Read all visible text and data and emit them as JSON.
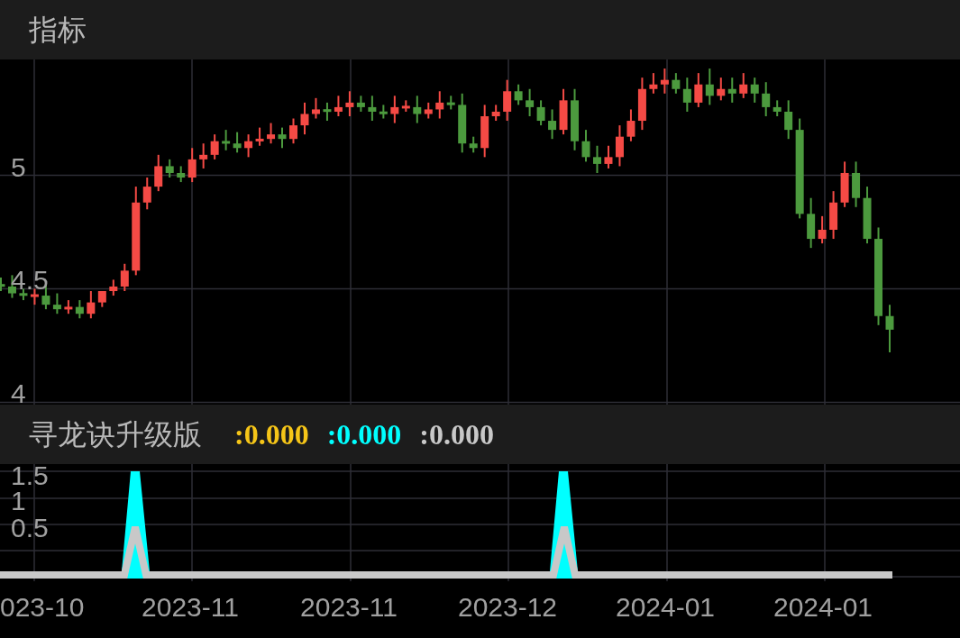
{
  "indicator_header": {
    "title": "指标"
  },
  "price_chart": {
    "chart_data": {
      "type": "candlestick",
      "grid": true,
      "ylim": [
        3.99,
        5.51
      ],
      "yticks": [
        {
          "value": 5,
          "label": "5"
        },
        {
          "value": 4.5,
          "label": "4.5"
        },
        {
          "value": 4,
          "label": "4"
        }
      ],
      "ohlc": [
        [
          4.52,
          4.55,
          4.49,
          4.51
        ],
        [
          4.51,
          4.56,
          4.46,
          4.48
        ],
        [
          4.48,
          4.5,
          4.45,
          4.47
        ],
        [
          4.47,
          4.5,
          4.43,
          4.47
        ],
        [
          4.47,
          4.52,
          4.41,
          4.43
        ],
        [
          4.43,
          4.48,
          4.39,
          4.41
        ],
        [
          4.41,
          4.45,
          4.39,
          4.42
        ],
        [
          4.42,
          4.45,
          4.37,
          4.39
        ],
        [
          4.39,
          4.49,
          4.37,
          4.44
        ],
        [
          4.44,
          4.49,
          4.42,
          4.49
        ],
        [
          4.49,
          4.54,
          4.47,
          4.51
        ],
        [
          4.51,
          4.61,
          4.49,
          4.58
        ],
        [
          4.58,
          4.95,
          4.56,
          4.88
        ],
        [
          4.88,
          4.99,
          4.85,
          4.95
        ],
        [
          4.95,
          5.09,
          4.93,
          5.04
        ],
        [
          5.04,
          5.07,
          4.99,
          5.01
        ],
        [
          5.01,
          5.04,
          4.97,
          4.99
        ],
        [
          4.99,
          5.12,
          4.97,
          5.07
        ],
        [
          5.07,
          5.14,
          5.03,
          5.09
        ],
        [
          5.09,
          5.18,
          5.07,
          5.15
        ],
        [
          5.15,
          5.2,
          5.11,
          5.14
        ],
        [
          5.14,
          5.19,
          5.1,
          5.12
        ],
        [
          5.12,
          5.18,
          5.08,
          5.15
        ],
        [
          5.15,
          5.21,
          5.13,
          5.16
        ],
        [
          5.16,
          5.23,
          5.14,
          5.18
        ],
        [
          5.18,
          5.21,
          5.12,
          5.16
        ],
        [
          5.16,
          5.25,
          5.14,
          5.22
        ],
        [
          5.22,
          5.32,
          5.18,
          5.27
        ],
        [
          5.27,
          5.34,
          5.25,
          5.29
        ],
        [
          5.29,
          5.32,
          5.24,
          5.28
        ],
        [
          5.28,
          5.35,
          5.26,
          5.3
        ],
        [
          5.3,
          5.37,
          5.26,
          5.32
        ],
        [
          5.32,
          5.35,
          5.28,
          5.3
        ],
        [
          5.3,
          5.35,
          5.24,
          5.28
        ],
        [
          5.28,
          5.31,
          5.25,
          5.27
        ],
        [
          5.27,
          5.35,
          5.23,
          5.3
        ],
        [
          5.3,
          5.33,
          5.28,
          5.3
        ],
        [
          5.3,
          5.35,
          5.23,
          5.27
        ],
        [
          5.27,
          5.32,
          5.25,
          5.29
        ],
        [
          5.29,
          5.37,
          5.25,
          5.32
        ],
        [
          5.32,
          5.35,
          5.29,
          5.31
        ],
        [
          5.31,
          5.36,
          5.1,
          5.14
        ],
        [
          5.14,
          5.17,
          5.1,
          5.12
        ],
        [
          5.12,
          5.31,
          5.08,
          5.26
        ],
        [
          5.26,
          5.31,
          5.24,
          5.28
        ],
        [
          5.28,
          5.42,
          5.24,
          5.37
        ],
        [
          5.37,
          5.4,
          5.31,
          5.33
        ],
        [
          5.33,
          5.38,
          5.26,
          5.3
        ],
        [
          5.3,
          5.33,
          5.22,
          5.24
        ],
        [
          5.24,
          5.29,
          5.16,
          5.2
        ],
        [
          5.2,
          5.38,
          5.18,
          5.33
        ],
        [
          5.33,
          5.38,
          5.11,
          5.15
        ],
        [
          5.15,
          5.2,
          5.06,
          5.08
        ],
        [
          5.08,
          5.13,
          5.01,
          5.05
        ],
        [
          5.05,
          5.13,
          5.03,
          5.08
        ],
        [
          5.08,
          5.22,
          5.04,
          5.17
        ],
        [
          5.17,
          5.29,
          5.15,
          5.24
        ],
        [
          5.24,
          5.43,
          5.2,
          5.38
        ],
        [
          5.38,
          5.45,
          5.36,
          5.4
        ],
        [
          5.4,
          5.47,
          5.36,
          5.42
        ],
        [
          5.42,
          5.45,
          5.36,
          5.38
        ],
        [
          5.38,
          5.43,
          5.28,
          5.32
        ],
        [
          5.32,
          5.45,
          5.3,
          5.4
        ],
        [
          5.4,
          5.47,
          5.31,
          5.35
        ],
        [
          5.35,
          5.43,
          5.33,
          5.38
        ],
        [
          5.38,
          5.43,
          5.32,
          5.36
        ],
        [
          5.36,
          5.45,
          5.34,
          5.4
        ],
        [
          5.4,
          5.43,
          5.32,
          5.36
        ],
        [
          5.36,
          5.41,
          5.26,
          5.3
        ],
        [
          5.3,
          5.33,
          5.26,
          5.28
        ],
        [
          5.28,
          5.33,
          5.16,
          5.2
        ],
        [
          5.2,
          5.25,
          4.81,
          4.83
        ],
        [
          4.83,
          4.9,
          4.68,
          4.72
        ],
        [
          4.72,
          4.82,
          4.7,
          4.76
        ],
        [
          4.76,
          4.93,
          4.72,
          4.88
        ],
        [
          4.88,
          5.06,
          4.86,
          5.01
        ],
        [
          5.01,
          5.06,
          4.86,
          4.9
        ],
        [
          4.9,
          4.95,
          4.7,
          4.72
        ],
        [
          4.72,
          4.77,
          4.34,
          4.38
        ],
        [
          4.38,
          4.43,
          4.22,
          4.32
        ]
      ]
    }
  },
  "sub_indicator": {
    "title": "寻龙诀升级版",
    "values": [
      {
        "text": ":0.000",
        "color": "#f5c518"
      },
      {
        "text": ":0.000",
        "color": "#00ffff"
      },
      {
        "text": ":0.000",
        "color": "#c8c8c8"
      }
    ],
    "y_labels": [
      "1.5",
      "1",
      "0.5"
    ]
  },
  "x_axis": {
    "labels": [
      "023-10",
      "2023-11",
      "2023-11",
      "2023-12",
      "2024-01",
      "2024-01"
    ]
  }
}
